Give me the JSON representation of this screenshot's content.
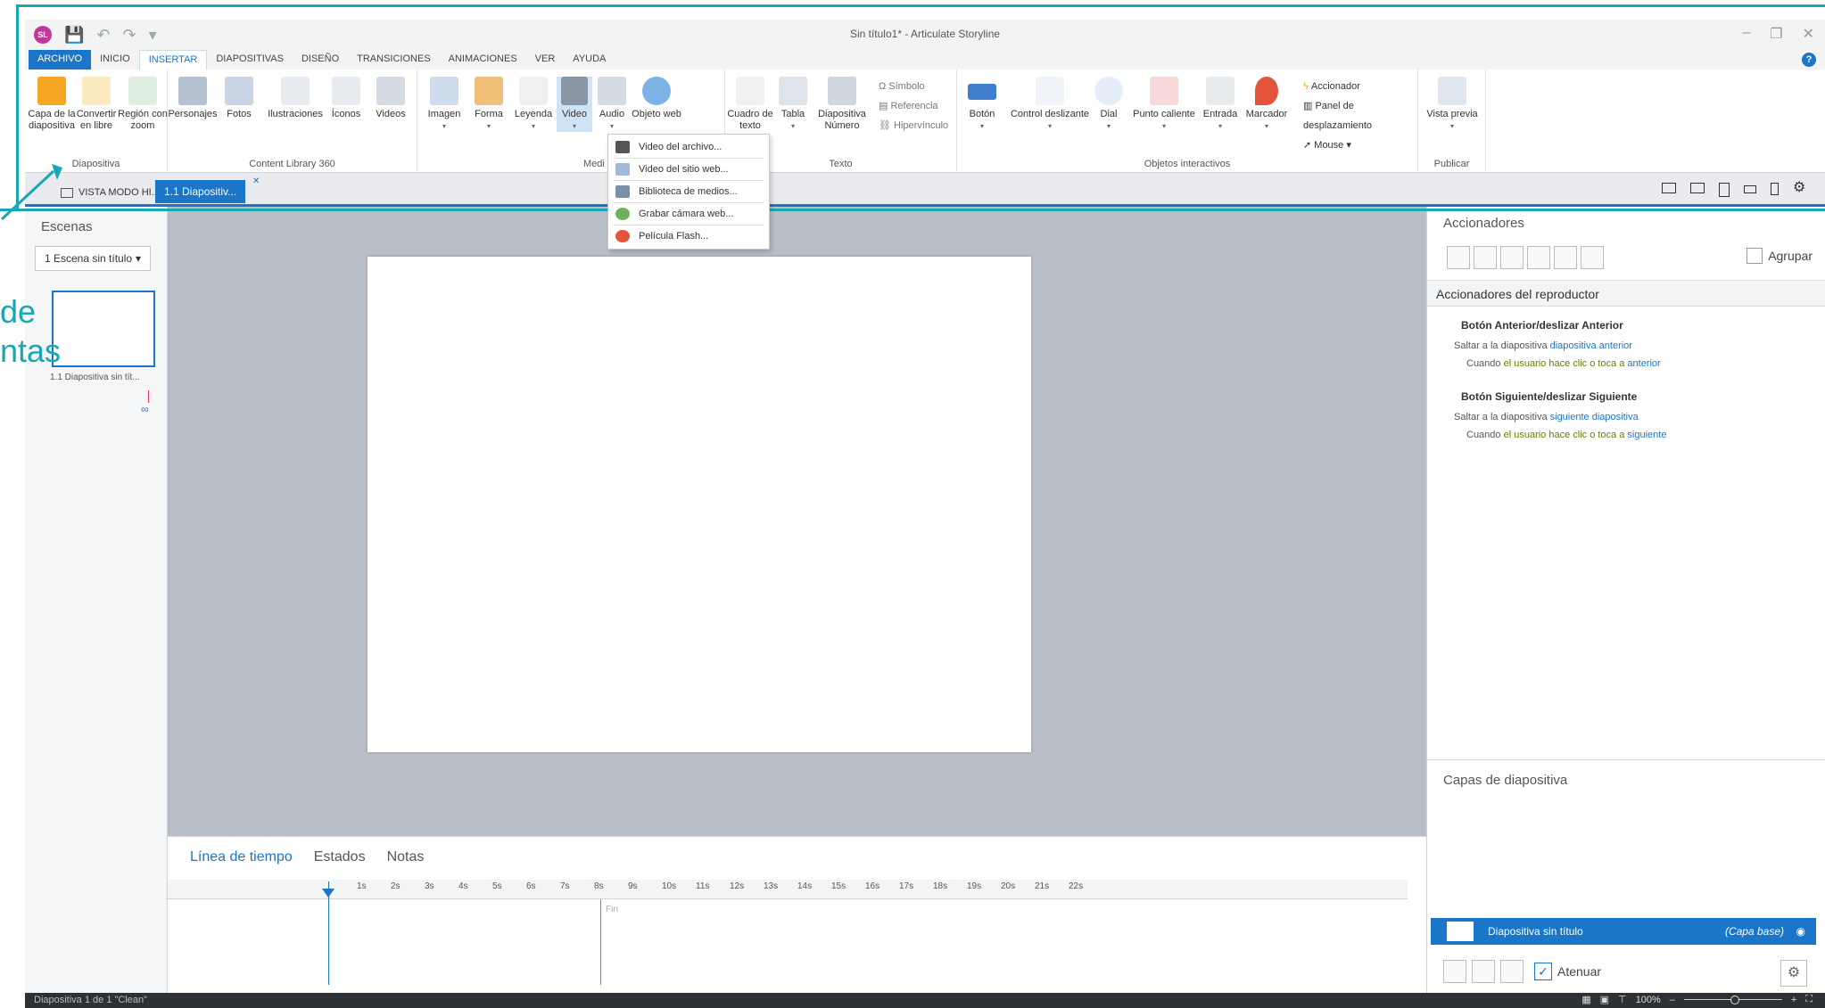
{
  "window": {
    "title": "Sin título1* - Articulate Storyline",
    "avatar_initials": "SL"
  },
  "menu_tabs": [
    "ARCHIVO",
    "INICIO",
    "INSERTAR",
    "DIAPOSITIVAS",
    "DISEÑO",
    "TRANSICIONES",
    "ANIMACIONES",
    "VER",
    "AYUDA"
  ],
  "ribbon": {
    "group_diapositiva": {
      "title": "Diapositiva",
      "buttons": [
        "Capa de la diapositiva",
        "Convertir en libre",
        "Región con zoom"
      ]
    },
    "group_content": {
      "title": "Content Library 360",
      "buttons": [
        "Personajes",
        "Fotos",
        "Ilustraciones",
        "Íconos",
        "Videos"
      ]
    },
    "group_medios": {
      "title": "Medi",
      "buttons": [
        "Imagen",
        "Forma",
        "Leyenda",
        "Video",
        "Audio",
        "Objeto web"
      ]
    },
    "group_texto": {
      "title": "Texto",
      "buttons": [
        "Cuadro de texto",
        "Tabla",
        "Diapositiva Número"
      ],
      "small": [
        "Símbolo",
        "Referencia",
        "Hipervínculo"
      ]
    },
    "group_interactivos": {
      "title": "Objetos interactivos",
      "buttons": [
        "Botón",
        "Control deslizante",
        "Dial",
        "Punto caliente",
        "Entrada",
        "Marcador"
      ],
      "small": [
        "Accionador",
        "Panel de desplazamiento",
        "Mouse"
      ]
    },
    "group_publicar": {
      "title": "Publicar",
      "buttons": [
        "Vista previa"
      ]
    }
  },
  "video_menu": [
    "Video del archivo...",
    "Video del sitio web...",
    "Biblioteca de medios...",
    "Grabar cámara web...",
    "Película Flash..."
  ],
  "doc_tabs": {
    "story": "VISTA MODO HI...",
    "slide": "1.1 Diapositiv..."
  },
  "scenes": {
    "title": "Escenas",
    "selected": "1 Escena sin título",
    "thumb_label": "1.1 Diapositiva sin tít..."
  },
  "timeline": {
    "tabs": [
      "Línea de tiempo",
      "Estados",
      "Notas"
    ],
    "ticks": [
      "1s",
      "2s",
      "3s",
      "4s",
      "5s",
      "6s",
      "7s",
      "8s",
      "9s",
      "10s",
      "11s",
      "12s",
      "13s",
      "14s",
      "15s",
      "16s",
      "17s",
      "18s",
      "19s",
      "20s",
      "21s",
      "22s"
    ],
    "end_label": "Fin"
  },
  "triggers": {
    "title": "Accionadores",
    "group_label": "Agrupar",
    "section": "Accionadores del reproductor",
    "items": [
      {
        "head": "Botón Anterior/deslizar Anterior",
        "l1a": "Saltar a la diapositiva ",
        "l1b": "diapositiva anterior",
        "l2a": "Cuando ",
        "l2b": "el usuario hace clic o toca a ",
        "l2c": "anterior"
      },
      {
        "head": "Botón Siguiente/deslizar Siguiente",
        "l1a": "Saltar a la diapositiva ",
        "l1b": "siguiente diapositiva",
        "l2a": "Cuando ",
        "l2b": "el usuario hace clic o toca a ",
        "l2c": "siguiente"
      }
    ]
  },
  "layers": {
    "title": "Capas de diapositiva",
    "row_name": "Diapositiva sin título",
    "row_base": "(Capa base)",
    "dim_label": "Atenuar"
  },
  "status": {
    "left": "Diapositiva 1 de 1   \"Clean\"",
    "zoom": "100%"
  },
  "overlay": {
    "line1": "de",
    "line2": "ntas"
  },
  "colors": {
    "accent": "#1b75c9",
    "annotation": "#18a7b5"
  }
}
